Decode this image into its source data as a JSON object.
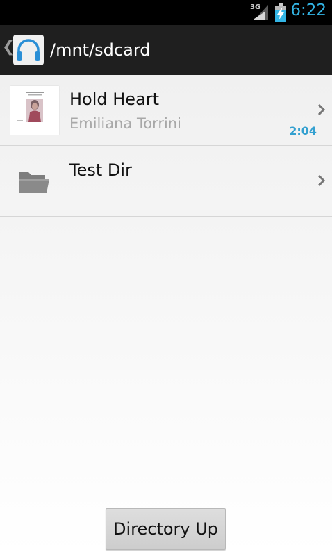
{
  "status_bar": {
    "network": "3G",
    "time": "6:22",
    "signal_icon": "signal-strength-icon",
    "battery_icon": "battery-charging-icon"
  },
  "action_bar": {
    "up_icon": "up-caret-icon",
    "app_icon": "headphones-icon",
    "title": "/mnt/sdcard"
  },
  "list": {
    "items": [
      {
        "type": "track",
        "title": "Hold Heart",
        "subtitle": "Emiliana Torrini",
        "duration": "2:04",
        "icon": "album-art-thumbnail"
      },
      {
        "type": "folder",
        "title": "Test Dir",
        "icon": "folder-icon"
      }
    ]
  },
  "footer": {
    "directory_up_label": "Directory Up"
  },
  "colors": {
    "accent": "#33b5e5",
    "duration": "#33a0d0",
    "action_bar": "#1f1f1f"
  }
}
